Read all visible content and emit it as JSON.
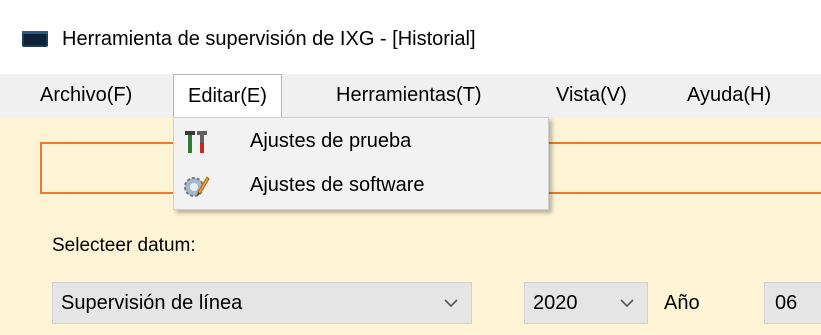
{
  "window": {
    "title": "Herramienta de supervisión de IXG - [Historial]",
    "icon": "app-window-icon"
  },
  "menubar": {
    "items": [
      {
        "label": "Archivo(F)"
      },
      {
        "label": "Editar(E)",
        "open": true
      },
      {
        "label": "Herramientas(T)"
      },
      {
        "label": "Vista(V)"
      },
      {
        "label": "Ayuda(H)"
      }
    ]
  },
  "edit_menu": {
    "items": [
      {
        "label": "Ajustes de prueba",
        "icon": "tools-icon"
      },
      {
        "label": "Ajustes de software",
        "icon": "software-settings-icon"
      }
    ]
  },
  "form": {
    "select_date_label": "Selecteer datum:",
    "type_select_value": "Supervisión de línea",
    "year_select_value": "2020",
    "year_label": "Año",
    "month_value": "06"
  },
  "colors": {
    "client_bg": "#fdf4d6",
    "accent_border": "#f0782a",
    "menubar_bg": "#f0f0f0"
  }
}
